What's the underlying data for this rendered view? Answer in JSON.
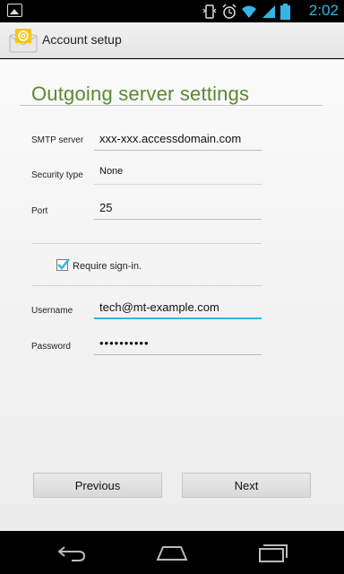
{
  "status_bar": {
    "time": "2:02"
  },
  "action_bar": {
    "title": "Account setup",
    "icon": "email-app-icon"
  },
  "page": {
    "title": "Outgoing server settings"
  },
  "form": {
    "smtp_server": {
      "label": "SMTP server",
      "value": "xxx-xxx.accessdomain.com"
    },
    "security_type": {
      "label": "Security type",
      "value": "None"
    },
    "port": {
      "label": "Port",
      "value": "25"
    },
    "require_signin": {
      "label": "Require sign-in.",
      "checked": true
    },
    "username": {
      "label": "Username",
      "value": "tech@mt-example.com"
    },
    "password": {
      "label": "Password",
      "value": "••••••••••"
    }
  },
  "buttons": {
    "previous": "Previous",
    "next": "Next"
  },
  "colors": {
    "title_green": "#5a8a2e",
    "accent_blue": "#33b5e5"
  }
}
